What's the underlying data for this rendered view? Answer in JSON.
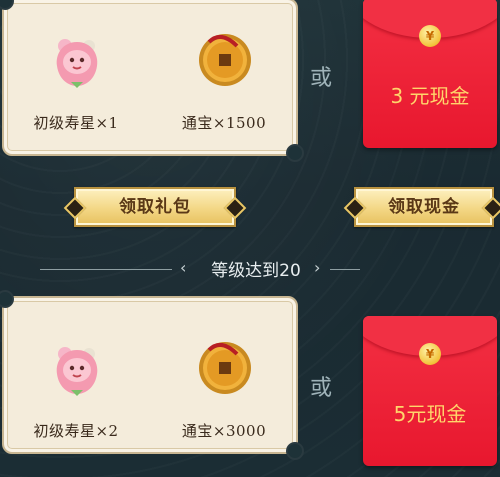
{
  "tier1": {
    "item_1": {
      "label": "初级寿星×1",
      "icon": "peach-star-icon"
    },
    "item_2": {
      "label": "通宝×1500",
      "icon": "coin-icon"
    },
    "or_text": "或",
    "envelope_text": "3 元现金"
  },
  "buttons": {
    "claim_gift": "领取礼包",
    "claim_cash": "领取现金"
  },
  "level_divider": {
    "text": "等级达到20"
  },
  "tier2": {
    "item_1": {
      "label": "初级寿星×2",
      "icon": "peach-star-icon"
    },
    "item_2": {
      "label": "通宝×3000",
      "icon": "coin-icon"
    },
    "or_text": "或",
    "envelope_text": "5元现金"
  },
  "colors": {
    "background": "#1b2d34",
    "card": "#f4ecdb",
    "envelope_red": "#e8172e",
    "envelope_text": "#ffd56b",
    "button_gold": "#f3d785"
  }
}
